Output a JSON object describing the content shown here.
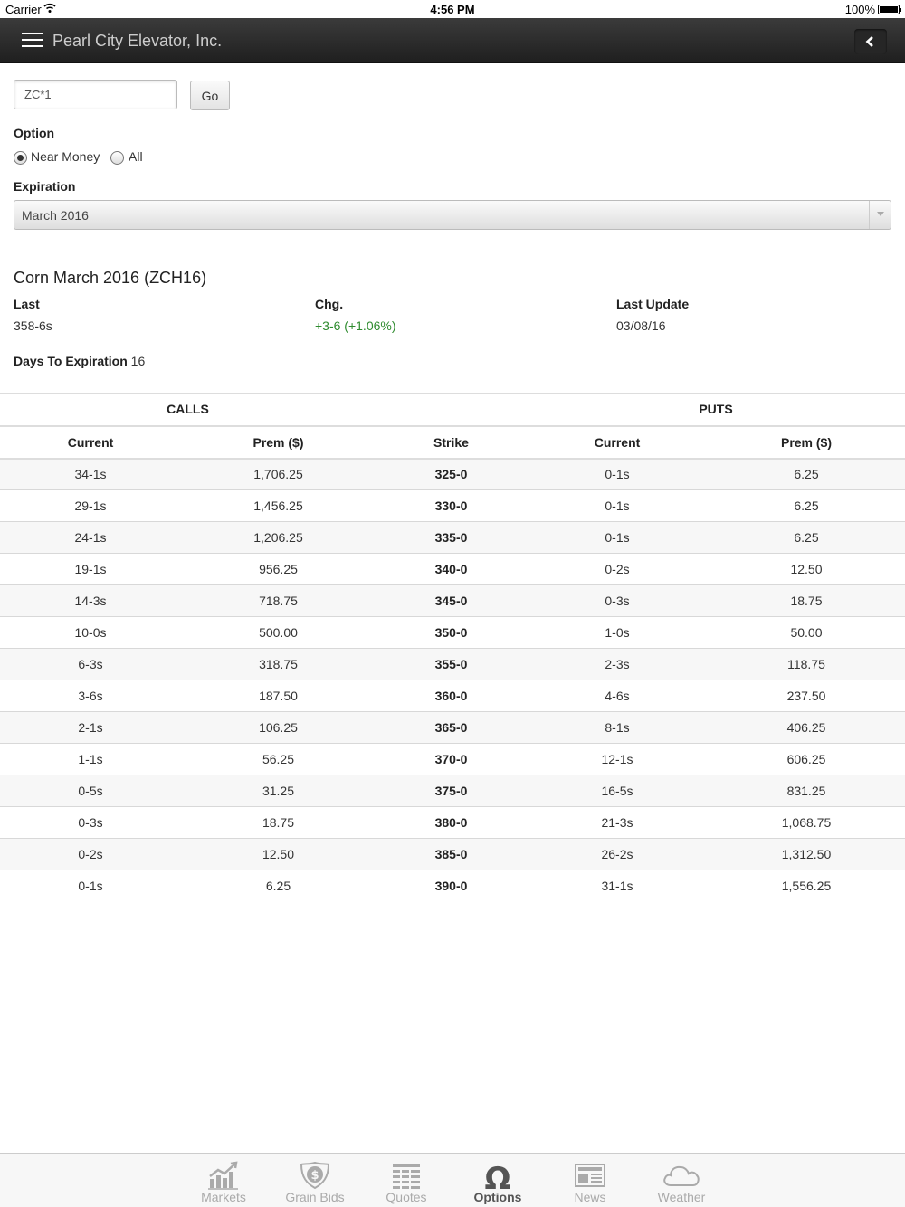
{
  "status_bar": {
    "carrier": "Carrier",
    "time": "4:56 PM",
    "battery": "100%"
  },
  "header": {
    "title": "Pearl City Elevator, Inc."
  },
  "search": {
    "value": "ZC*1",
    "go_label": "Go"
  },
  "option": {
    "label": "Option",
    "choices": [
      {
        "label": "Near Money",
        "selected": true
      },
      {
        "label": "All",
        "selected": false
      }
    ]
  },
  "expiration": {
    "label": "Expiration",
    "selected": "March 2016"
  },
  "contract": {
    "title": "Corn March 2016 (ZCH16)",
    "last_label": "Last",
    "last_value": "358-6s",
    "chg_label": "Chg.",
    "chg_value": "+3-6 (+1.06%)",
    "update_label": "Last Update",
    "update_value": "03/08/16",
    "days_label": "Days To Expiration",
    "days_value": "16"
  },
  "colors": {
    "positive": "#2e8b2e",
    "header_bg": "#2a2a2a"
  },
  "table": {
    "calls_label": "CALLS",
    "puts_label": "PUTS",
    "columns": [
      "Current",
      "Prem ($)",
      "Strike",
      "Current",
      "Prem ($)"
    ],
    "rows": [
      [
        "34-1s",
        "1,706.25",
        "325-0",
        "0-1s",
        "6.25"
      ],
      [
        "29-1s",
        "1,456.25",
        "330-0",
        "0-1s",
        "6.25"
      ],
      [
        "24-1s",
        "1,206.25",
        "335-0",
        "0-1s",
        "6.25"
      ],
      [
        "19-1s",
        "956.25",
        "340-0",
        "0-2s",
        "12.50"
      ],
      [
        "14-3s",
        "718.75",
        "345-0",
        "0-3s",
        "18.75"
      ],
      [
        "10-0s",
        "500.00",
        "350-0",
        "1-0s",
        "50.00"
      ],
      [
        "6-3s",
        "318.75",
        "355-0",
        "2-3s",
        "118.75"
      ],
      [
        "3-6s",
        "187.50",
        "360-0",
        "4-6s",
        "237.50"
      ],
      [
        "2-1s",
        "106.25",
        "365-0",
        "8-1s",
        "406.25"
      ],
      [
        "1-1s",
        "56.25",
        "370-0",
        "12-1s",
        "606.25"
      ],
      [
        "0-5s",
        "31.25",
        "375-0",
        "16-5s",
        "831.25"
      ],
      [
        "0-3s",
        "18.75",
        "380-0",
        "21-3s",
        "1,068.75"
      ],
      [
        "0-2s",
        "12.50",
        "385-0",
        "26-2s",
        "1,312.50"
      ],
      [
        "0-1s",
        "6.25",
        "390-0",
        "31-1s",
        "1,556.25"
      ]
    ]
  },
  "tabs": [
    {
      "label": "Markets",
      "icon": "chart-icon",
      "active": false
    },
    {
      "label": "Grain Bids",
      "icon": "dollar-shield-icon",
      "active": false
    },
    {
      "label": "Quotes",
      "icon": "quotes-table-icon",
      "active": false
    },
    {
      "label": "Options",
      "icon": "omega-icon",
      "active": true
    },
    {
      "label": "News",
      "icon": "newspaper-icon",
      "active": false
    },
    {
      "label": "Weather",
      "icon": "cloud-icon",
      "active": false
    }
  ]
}
